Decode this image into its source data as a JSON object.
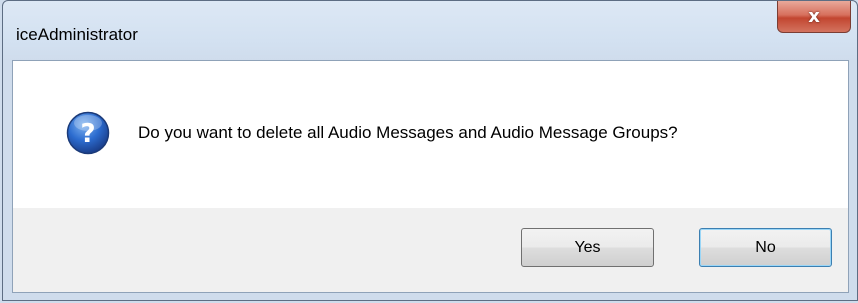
{
  "window": {
    "title": "iceAdministrator",
    "close_glyph": "x"
  },
  "dialog": {
    "icon": "question-icon",
    "message": "Do you want to delete all Audio Messages and Audio Message Groups?"
  },
  "buttons": {
    "yes_label": "Yes",
    "no_label": "No"
  },
  "colors": {
    "frame": "#cfdcec",
    "close_button": "#c24630",
    "content_bg": "#ffffff",
    "button_bar_bg": "#f0f0f0",
    "default_button_border": "#3c7fb1"
  }
}
